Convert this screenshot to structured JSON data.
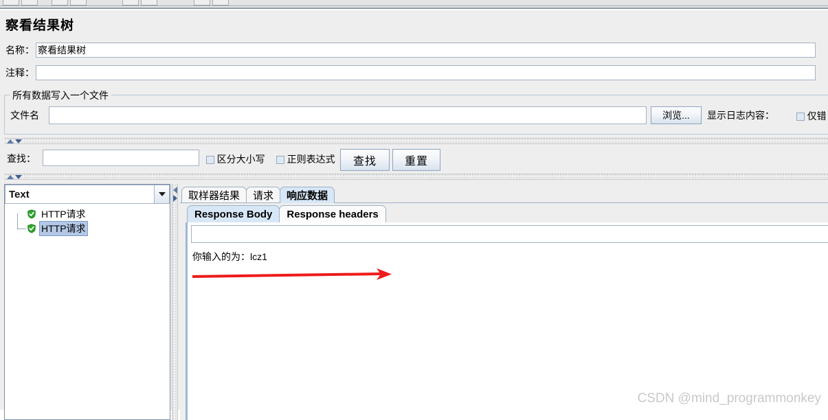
{
  "toolbar": {
    "groups": [
      2,
      2,
      2,
      2
    ]
  },
  "page": {
    "title": "察看结果树"
  },
  "fields": {
    "name_label": "名称：",
    "name_value": "察看结果树",
    "comment_label": "注释：",
    "comment_value": ""
  },
  "file_group": {
    "title": "所有数据写入一个文件",
    "filename_label": "文件名",
    "filename_value": "",
    "browse_button": "浏览...",
    "log_display_label": "显示日志内容：",
    "errors_only_label": "仅错"
  },
  "search_bar": {
    "find_label": "查找：",
    "find_value": "",
    "case_sensitive_label": "区分大小写",
    "regex_label": "正则表达式",
    "find_button": "查找",
    "reset_button": "重置"
  },
  "tree_panel": {
    "renderer_selected": "Text",
    "nodes": [
      {
        "label": "HTTP请求",
        "icon": "green-shield-check-icon",
        "selected": false
      },
      {
        "label": "HTTP请求",
        "icon": "green-shield-check-icon",
        "selected": true
      }
    ]
  },
  "results": {
    "tabs": [
      {
        "label": "取样器结果",
        "active": false
      },
      {
        "label": "请求",
        "active": false
      },
      {
        "label": "响应数据",
        "active": true
      }
    ],
    "subtabs": [
      {
        "label": "Response Body",
        "active": true
      },
      {
        "label": "Response headers",
        "active": false
      }
    ],
    "body_search_value": "",
    "body_text": "你输入的为：lcz1"
  },
  "annotation": {
    "arrow_color": "#ee1b1b"
  },
  "watermark": {
    "text": "CSDN @mind_programmonkey"
  }
}
